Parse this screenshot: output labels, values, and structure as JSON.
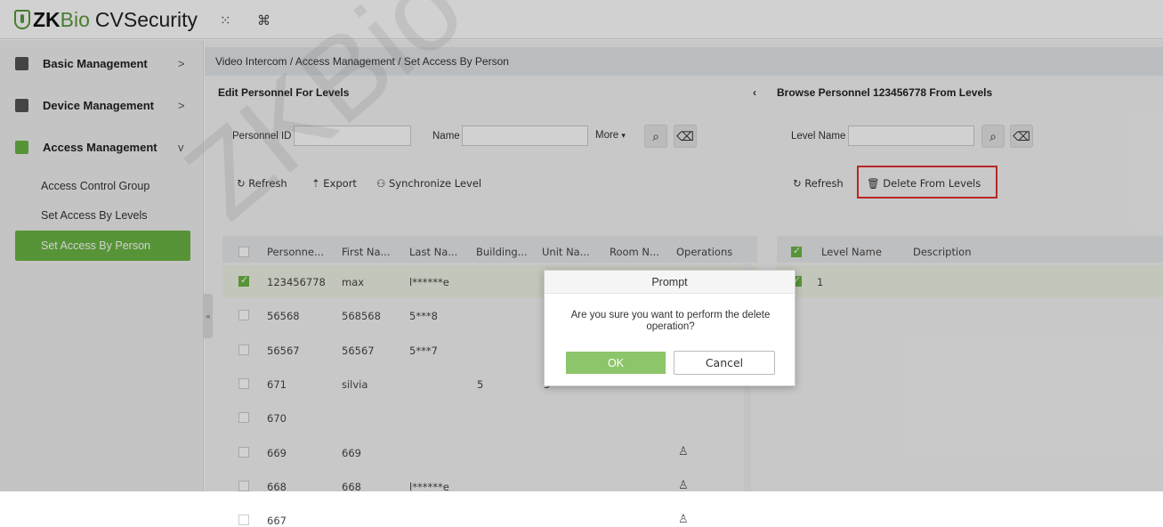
{
  "app": {
    "logo_zk": "ZK",
    "logo_bio": "Bio",
    "logo_cv": "CVSecurity"
  },
  "topbar": {
    "grid_icon": "grid-icon",
    "command_icon": "command-icon"
  },
  "sidebar": {
    "menus": [
      {
        "label": "Basic Management",
        "arrow": ">"
      },
      {
        "label": "Device Management",
        "arrow": ">"
      },
      {
        "label": "Access Management",
        "arrow": "v"
      }
    ],
    "submenu": [
      "Access Control Group",
      "Set Access By Levels",
      "Set Access By Person"
    ]
  },
  "breadcrumb": "Video Intercom / Access Management / Set Access By Person",
  "left_panel": {
    "title": "Edit Personnel For Levels",
    "collapse": "‹",
    "personnel_id_label": "Personnel ID",
    "name_label": "Name",
    "more_label": "More",
    "refresh": "Refresh",
    "export": "Export",
    "sync": "Synchronize Level",
    "columns": [
      "Personne...",
      "First Na...",
      "Last Na...",
      "Building...",
      "Unit Na...",
      "Room N...",
      "Operations"
    ],
    "rows": [
      {
        "id": "123456778",
        "first": "max",
        "last": "l******e",
        "building": "",
        "unit": "",
        "room": "",
        "checked": true,
        "op": true
      },
      {
        "id": "56568",
        "first": "568568",
        "last": "5***8",
        "building": "",
        "unit": "",
        "room": "",
        "checked": false,
        "op": false
      },
      {
        "id": "56567",
        "first": "56567",
        "last": "5***7",
        "building": "",
        "unit": "",
        "room": "",
        "checked": false,
        "op": false
      },
      {
        "id": "671",
        "first": "silvia",
        "last": "",
        "building": "5",
        "unit": "5",
        "room": "",
        "checked": false,
        "op": false
      },
      {
        "id": "670",
        "first": "",
        "last": "",
        "building": "",
        "unit": "",
        "room": "",
        "checked": false,
        "op": false
      },
      {
        "id": "669",
        "first": "669",
        "last": "",
        "building": "",
        "unit": "",
        "room": "",
        "checked": false,
        "op": true
      },
      {
        "id": "668",
        "first": "668",
        "last": "l******e",
        "building": "",
        "unit": "",
        "room": "",
        "checked": false,
        "op": true
      },
      {
        "id": "667",
        "first": "",
        "last": "",
        "building": "",
        "unit": "",
        "room": "",
        "checked": false,
        "op": true
      }
    ]
  },
  "right_panel": {
    "title": "Browse Personnel 123456778 From Levels",
    "level_name_label": "Level Name",
    "refresh": "Refresh",
    "delete": "Delete From Levels",
    "columns": [
      "Level Name",
      "Description"
    ],
    "rows": [
      {
        "level": "1",
        "desc": ""
      }
    ]
  },
  "dialog": {
    "title": "Prompt",
    "message": "Are you sure you want to perform the delete operation?",
    "ok": "OK",
    "cancel": "Cancel"
  },
  "watermark": "ZKBio CVSecurity",
  "colors": {
    "accent": "#6bb544",
    "highlight": "#e03030"
  }
}
